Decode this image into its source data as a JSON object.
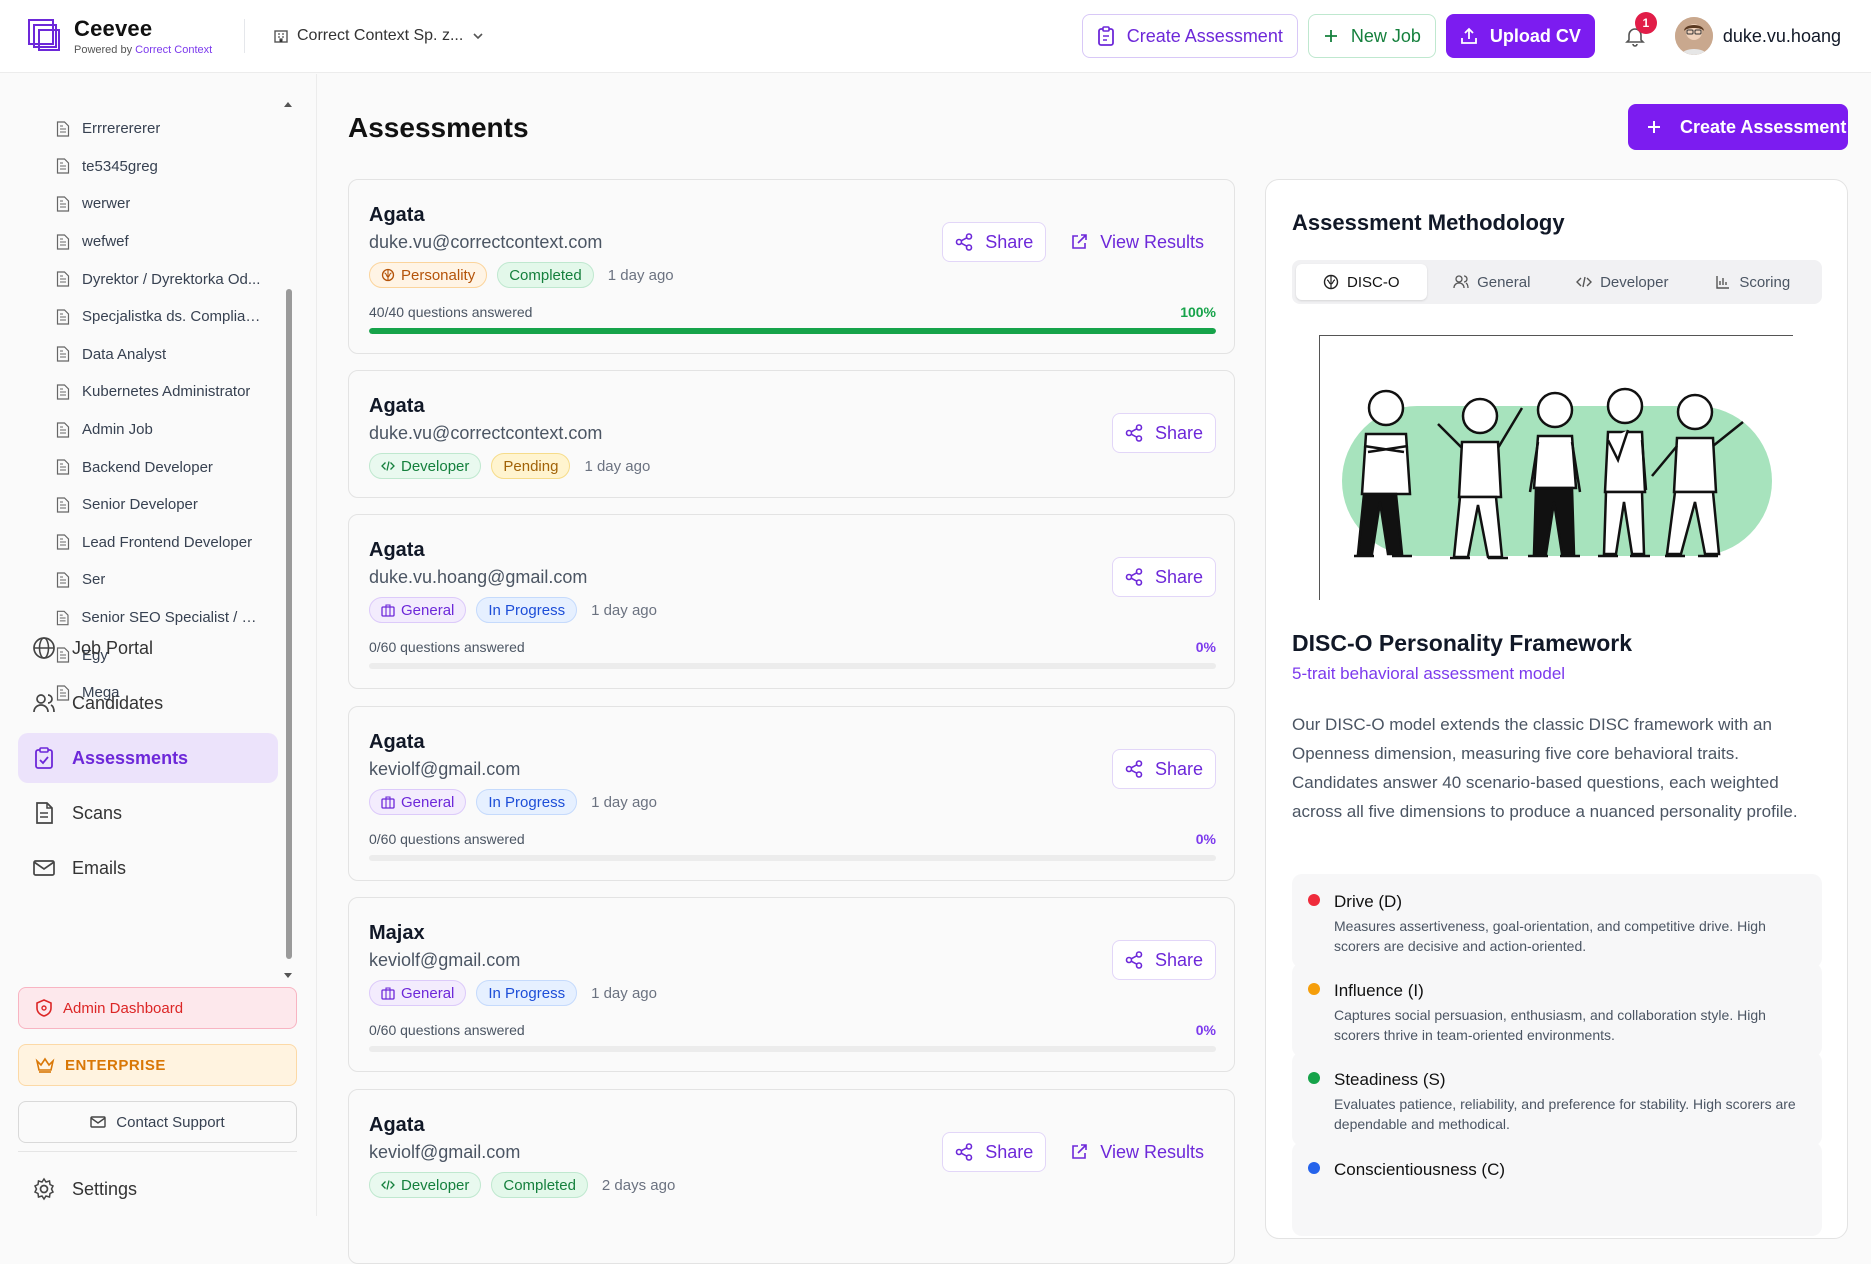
{
  "brand": {
    "name": "Ceevee",
    "powered_prefix": "Powered by ",
    "powered_by": "Correct Context"
  },
  "company": {
    "name": "Correct Context Sp. z..."
  },
  "header": {
    "create_assessment": "Create Assessment",
    "new_job": "New Job",
    "upload_cv": "Upload CV",
    "notifications": "1",
    "username": "duke.vu.hoang"
  },
  "sidebar": {
    "jobs": [
      "Errrerererer",
      "te5345greg",
      "werwer",
      "wefwef",
      "Dyrektor / Dyrektorka Od...",
      "Specjalistka ds. Complian...",
      "Data Analyst",
      "Kubernetes Administrator",
      "Admin Job",
      "Backend Developer",
      "Senior Developer",
      "Lead Frontend Developer",
      "Ser",
      "Senior SEO Specialist / SE...",
      "Egy",
      "Mega"
    ],
    "nav": {
      "job_portal": "Job Portal",
      "candidates": "Candidates",
      "assessments": "Assessments",
      "scans": "Scans",
      "emails": "Emails"
    },
    "admin": "Admin Dashboard",
    "enterprise": "ENTERPRISE",
    "contact": "Contact Support",
    "settings": "Settings"
  },
  "main": {
    "title": "Assessments",
    "create": "Create Assessment",
    "share_label": "Share",
    "view_results_label": "View Results",
    "cards": [
      {
        "name": "Agata",
        "email": "duke.vu@correctcontext.com",
        "type": "Personality",
        "status": "Completed",
        "ago": "1 day ago",
        "progress": "40/40 questions answered",
        "pct": "100%",
        "fraction": 1.0
      },
      {
        "name": "Agata",
        "email": "duke.vu@correctcontext.com",
        "type": "Developer",
        "status": "Pending",
        "ago": "1 day ago"
      },
      {
        "name": "Agata",
        "email": "duke.vu.hoang@gmail.com",
        "type": "General",
        "status": "In Progress",
        "ago": "1 day ago",
        "progress": "0/60 questions answered",
        "pct": "0%",
        "fraction": 0
      },
      {
        "name": "Agata",
        "email": "keviolf@gmail.com",
        "type": "General",
        "status": "In Progress",
        "ago": "1 day ago",
        "progress": "0/60 questions answered",
        "pct": "0%",
        "fraction": 0
      },
      {
        "name": "Majax",
        "email": "keviolf@gmail.com",
        "type": "General",
        "status": "In Progress",
        "ago": "1 day ago",
        "progress": "0/60 questions answered",
        "pct": "0%",
        "fraction": 0
      },
      {
        "name": "Agata",
        "email": "keviolf@gmail.com",
        "type": "Developer",
        "status": "Completed",
        "ago": "2 days ago"
      }
    ]
  },
  "panel": {
    "title": "Assessment Methodology",
    "tabs": [
      "DISC-O",
      "General",
      "Developer",
      "Scoring"
    ],
    "framework_title": "DISC-O Personality Framework",
    "framework_sub": "5-trait behavioral assessment model",
    "description": "Our DISC-O model extends the classic DISC framework with an Openness dimension, measuring five core behavioral traits. Candidates answer 40 scenario-based questions, each weighted across all five dimensions to produce a nuanced personality profile.",
    "traits": [
      {
        "name": "Drive (D)",
        "desc": "Measures assertiveness, goal-orientation, and competitive drive. High scorers are decisive and action-oriented.",
        "color": "#ef2b3b"
      },
      {
        "name": "Influence (I)",
        "desc": "Captures social persuasion, enthusiasm, and collaboration style. High scorers thrive in team-oriented environments.",
        "color": "#f59e0b"
      },
      {
        "name": "Steadiness (S)",
        "desc": "Evaluates patience, reliability, and preference for stability. High scorers are dependable and methodical.",
        "color": "#16a34a"
      },
      {
        "name": "Conscientiousness (C)",
        "desc": "",
        "color": "#2563eb"
      }
    ]
  },
  "colors": {
    "accent": "#7c1cf0",
    "success": "#16a34a"
  }
}
